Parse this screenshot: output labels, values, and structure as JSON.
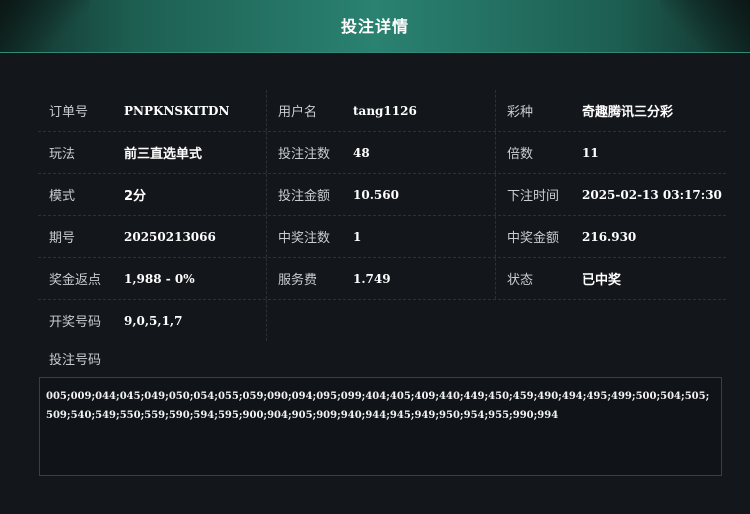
{
  "title": "投注详情",
  "rows": [
    [
      {
        "label": "订单号",
        "value": "PNPKNSKITDN"
      },
      {
        "label": "用户名",
        "value": "tang1126"
      },
      {
        "label": "彩种",
        "value": "奇趣腾讯三分彩"
      }
    ],
    [
      {
        "label": "玩法",
        "value": "前三直选单式"
      },
      {
        "label": "投注注数",
        "value": "48"
      },
      {
        "label": "倍数",
        "value": "11"
      }
    ],
    [
      {
        "label": "模式",
        "value": "2分"
      },
      {
        "label": "投注金额",
        "value": "10.560"
      },
      {
        "label": "下注时间",
        "value": "2025-02-13 03:17:30"
      }
    ],
    [
      {
        "label": "期号",
        "value": "20250213066"
      },
      {
        "label": "中奖注数",
        "value": "1"
      },
      {
        "label": "中奖金额",
        "value": "216.930"
      }
    ],
    [
      {
        "label": "奖金返点",
        "value": "1,988 - 0%"
      },
      {
        "label": "服务费",
        "value": "1.749"
      },
      {
        "label": "状态",
        "value": "已中奖"
      }
    ],
    [
      {
        "label": "开奖号码",
        "value": "9,0,5,1,7"
      }
    ]
  ],
  "bet_numbers_label": "投注号码",
  "bet_numbers": "005;009;044;045;049;050;054;055;059;090;094;095;099;404;405;409;440;449;450;459;490;494;495;499;500;504;505;509;540;549;550;559;590;594;595;900;904;905;909;940;944;945;949;950;954;955;990;994"
}
